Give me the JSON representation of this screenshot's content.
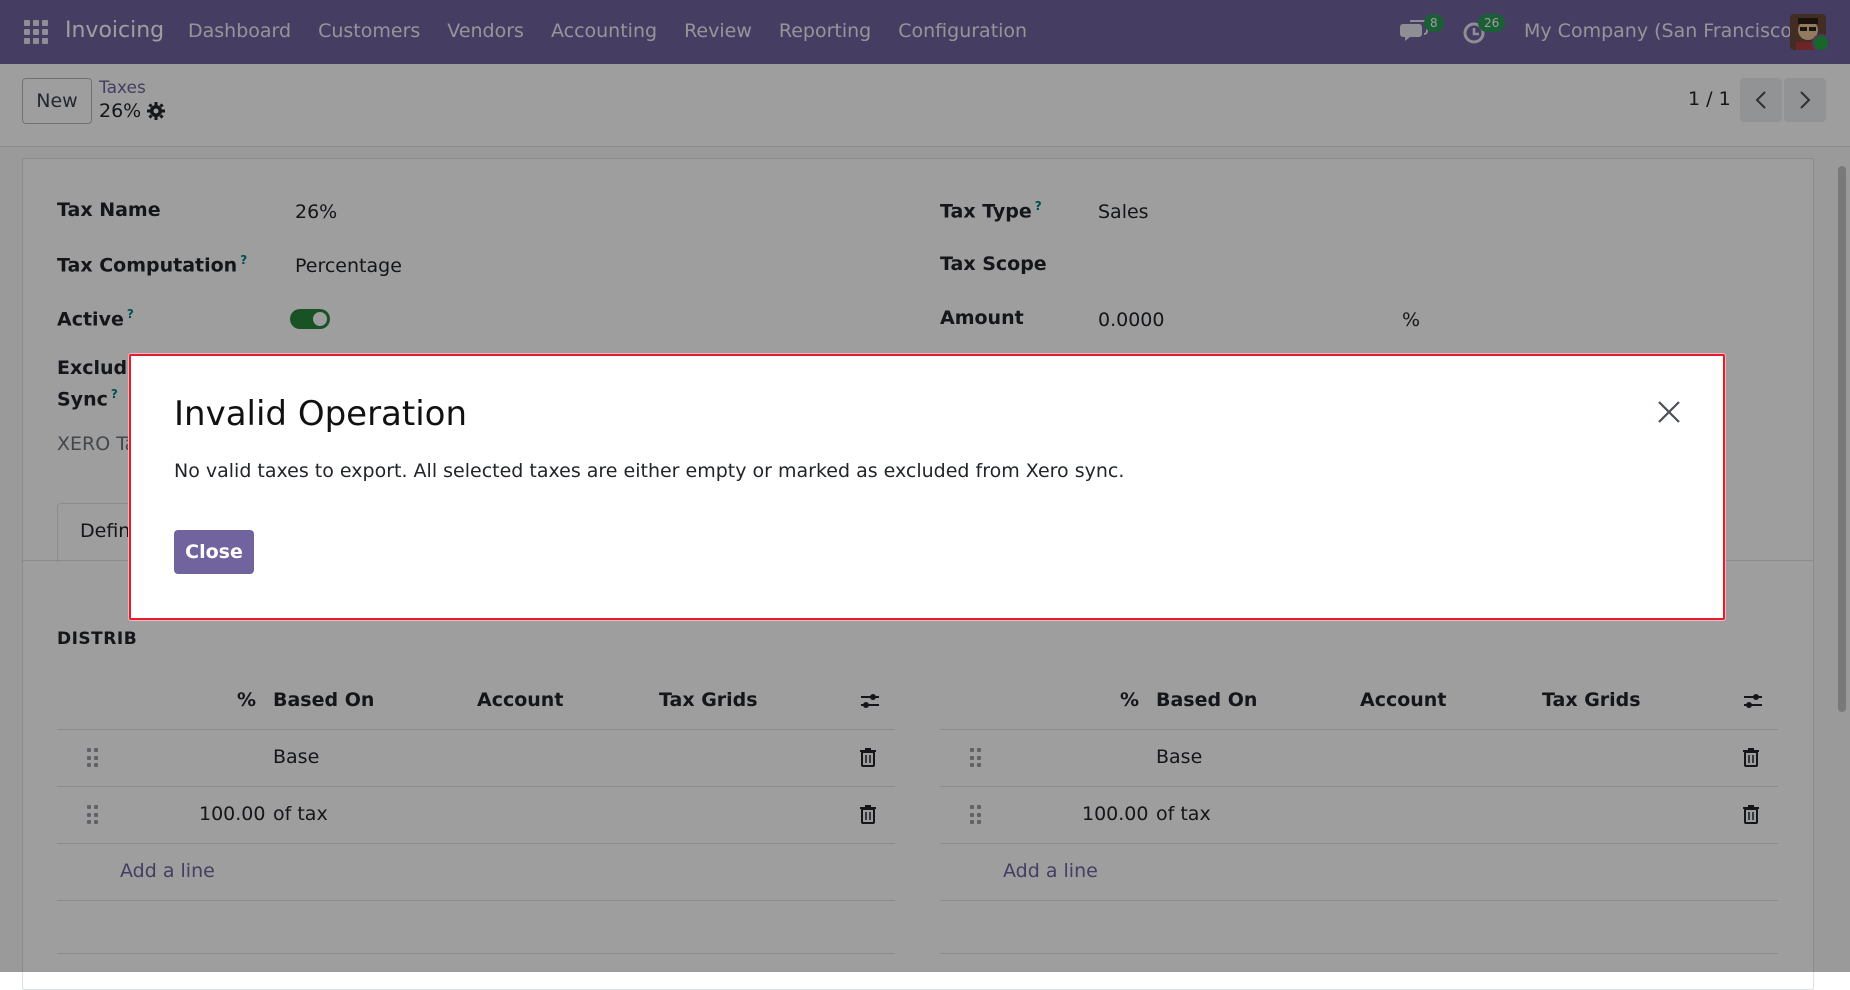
{
  "navbar": {
    "brand": "Invoicing",
    "menu": [
      "Dashboard",
      "Customers",
      "Vendors",
      "Accounting",
      "Review",
      "Reporting",
      "Configuration"
    ],
    "messages_count": "8",
    "activities_count": "26",
    "company": "My Company (San Francisco)"
  },
  "control_panel": {
    "new_label": "New",
    "breadcrumb_parent": "Taxes",
    "breadcrumb_current": "26%",
    "pager": "1 / 1"
  },
  "form": {
    "tax_name_label": "Tax Name",
    "tax_name_value": "26%",
    "tax_computation_label": "Tax Computation",
    "tax_computation_value": "Percentage",
    "active_label": "Active",
    "active_value": true,
    "exclude_label_1": "Exclude",
    "exclude_label_2": "Sync",
    "xero_label": "XERO Ta",
    "tax_type_label": "Tax Type",
    "tax_type_value": "Sales",
    "tax_scope_label": "Tax Scope",
    "amount_label": "Amount",
    "amount_value": "0.0000",
    "amount_unit": "%",
    "help_mark": "?",
    "tab_label": "Defin",
    "section_left": "DISTRIB",
    "grid_headers": [
      "%",
      "Based On",
      "Account",
      "Tax Grids"
    ],
    "rows": [
      {
        "percent": "",
        "based_on": "Base"
      },
      {
        "percent": "100.00",
        "based_on": "of tax"
      }
    ],
    "add_line": "Add a line"
  },
  "dialog": {
    "title": "Invalid Operation",
    "message": "No valid taxes to export. All selected taxes are either empty or marked as excluded from Xero sync.",
    "close_button": "Close"
  },
  "colors": {
    "brand": "#71639e",
    "toggle_on": "#28853d",
    "dialog_border": "#e11d2f",
    "badge": "#2b9a57"
  }
}
